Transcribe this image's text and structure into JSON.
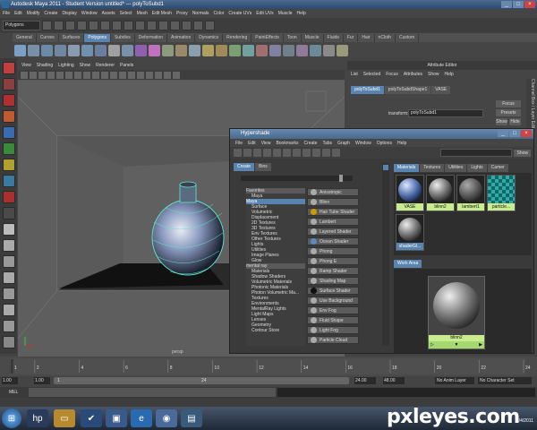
{
  "window": {
    "title": "Autodesk Maya 2011 - Student Version untitled* --- polyToSubd1",
    "controls": [
      "_",
      "□",
      "×"
    ]
  },
  "menubar": [
    "File",
    "Edit",
    "Modify",
    "Create",
    "Display",
    "Window",
    "Assets",
    "Select",
    "Mesh",
    "Edit Mesh",
    "Proxy",
    "Normals",
    "Color",
    "Create UVs",
    "Edit UVs",
    "Muscle",
    "Help"
  ],
  "status_line": {
    "mode": "Polygons"
  },
  "shelf": {
    "tabs": [
      "General",
      "Curves",
      "Surfaces",
      "Polygons",
      "Subdivs",
      "Deformation",
      "Animation",
      "Dynamics",
      "Rendering",
      "PaintEffects",
      "Toon",
      "Muscle",
      "Fluids",
      "Fur",
      "Hair",
      "nCloth",
      "Custom"
    ],
    "active_tab": "Polygons"
  },
  "viewport": {
    "menu": [
      "View",
      "Shading",
      "Lighting",
      "Show",
      "Renderer",
      "Panels"
    ],
    "camera_label": "persp"
  },
  "attribute_editor": {
    "title": "Attribute Editor",
    "menu": [
      "List",
      "Selected",
      "Focus",
      "Attributes",
      "Show",
      "Help"
    ],
    "tabs": [
      "polyToSubd1",
      "polyToSubdShape1",
      "VASE"
    ],
    "transform_label": "transform:",
    "transform_value": "polyToSubd1",
    "buttons": [
      "Focus",
      "Presets",
      "Show",
      "Hide"
    ],
    "side_tabs": [
      "Channel Box / Layer Editor",
      "Attribute Editor"
    ]
  },
  "hypershade": {
    "title": "Hypershade",
    "menu": [
      "File",
      "Edit",
      "View",
      "Bookmarks",
      "Create",
      "Tabs",
      "Graph",
      "Window",
      "Options",
      "Help"
    ],
    "show_button": "Show",
    "left_tabs": [
      "Create",
      "Bins"
    ],
    "tree": [
      {
        "label": "Favorites",
        "type": "hdr"
      },
      {
        "label": "Maya",
        "type": "item"
      },
      {
        "label": "Maya",
        "type": "sel"
      },
      {
        "label": "Surface",
        "type": "item"
      },
      {
        "label": "Volumetric",
        "type": "item"
      },
      {
        "label": "Displacement",
        "type": "item"
      },
      {
        "label": "2D Textures",
        "type": "item"
      },
      {
        "label": "3D Textures",
        "type": "item"
      },
      {
        "label": "Env Textures",
        "type": "item"
      },
      {
        "label": "Other Textures",
        "type": "item"
      },
      {
        "label": "Lights",
        "type": "item"
      },
      {
        "label": "Utilities",
        "type": "item"
      },
      {
        "label": "Image Planes",
        "type": "item"
      },
      {
        "label": "Glow",
        "type": "item"
      },
      {
        "label": "mental ray",
        "type": "hdr"
      },
      {
        "label": "Materials",
        "type": "item"
      },
      {
        "label": "Shadow Shaders",
        "type": "item"
      },
      {
        "label": "Volumetric Materials",
        "type": "item"
      },
      {
        "label": "Photonic Materials",
        "type": "item"
      },
      {
        "label": "Photon Volumetric Ma...",
        "type": "item"
      },
      {
        "label": "Textures",
        "type": "item"
      },
      {
        "label": "Environments",
        "type": "item"
      },
      {
        "label": "MentalRay Lights",
        "type": "item"
      },
      {
        "label": "Light Maps",
        "type": "item"
      },
      {
        "label": "Lenses",
        "type": "item"
      },
      {
        "label": "Geometry",
        "type": "item"
      },
      {
        "label": "Contour Store",
        "type": "item"
      }
    ],
    "node_buttons": [
      "Anisotropic",
      "Blinn",
      "Hair Tube Shader",
      "Lambert",
      "Layered Shader",
      "Ocean Shader",
      "Phong",
      "Phong E",
      "Ramp Shader",
      "Shading Map",
      "Surface Shader",
      "Use Background",
      "Env Fog",
      "Fluid Shape",
      "Light Fog",
      "Particle Cloud"
    ],
    "right_tabs": [
      "Materials",
      "Textures",
      "Utilities",
      "Lights",
      "Camer"
    ],
    "swatches": [
      "VASE",
      "blinn2",
      "lambert1",
      "particle...",
      "shaderGl..."
    ],
    "work_area_tab": "Work Area",
    "work_node_label": "blinn2"
  },
  "timeline": {
    "ticks": [
      "1",
      "2",
      "4",
      "6",
      "8",
      "10",
      "12",
      "14",
      "16",
      "18",
      "20",
      "22",
      "24"
    ],
    "start": "1.00",
    "start2": "1.00",
    "current": "1",
    "marker": "24",
    "end1": "24.00",
    "end2": "48.00",
    "anim_layer": "No Anim Layer",
    "char_set": "No Character Set"
  },
  "mel_label": "MEL",
  "taskbar": {
    "clock_time": "",
    "clock_date": "7/4/2011"
  },
  "watermark": "pxleyes.com"
}
